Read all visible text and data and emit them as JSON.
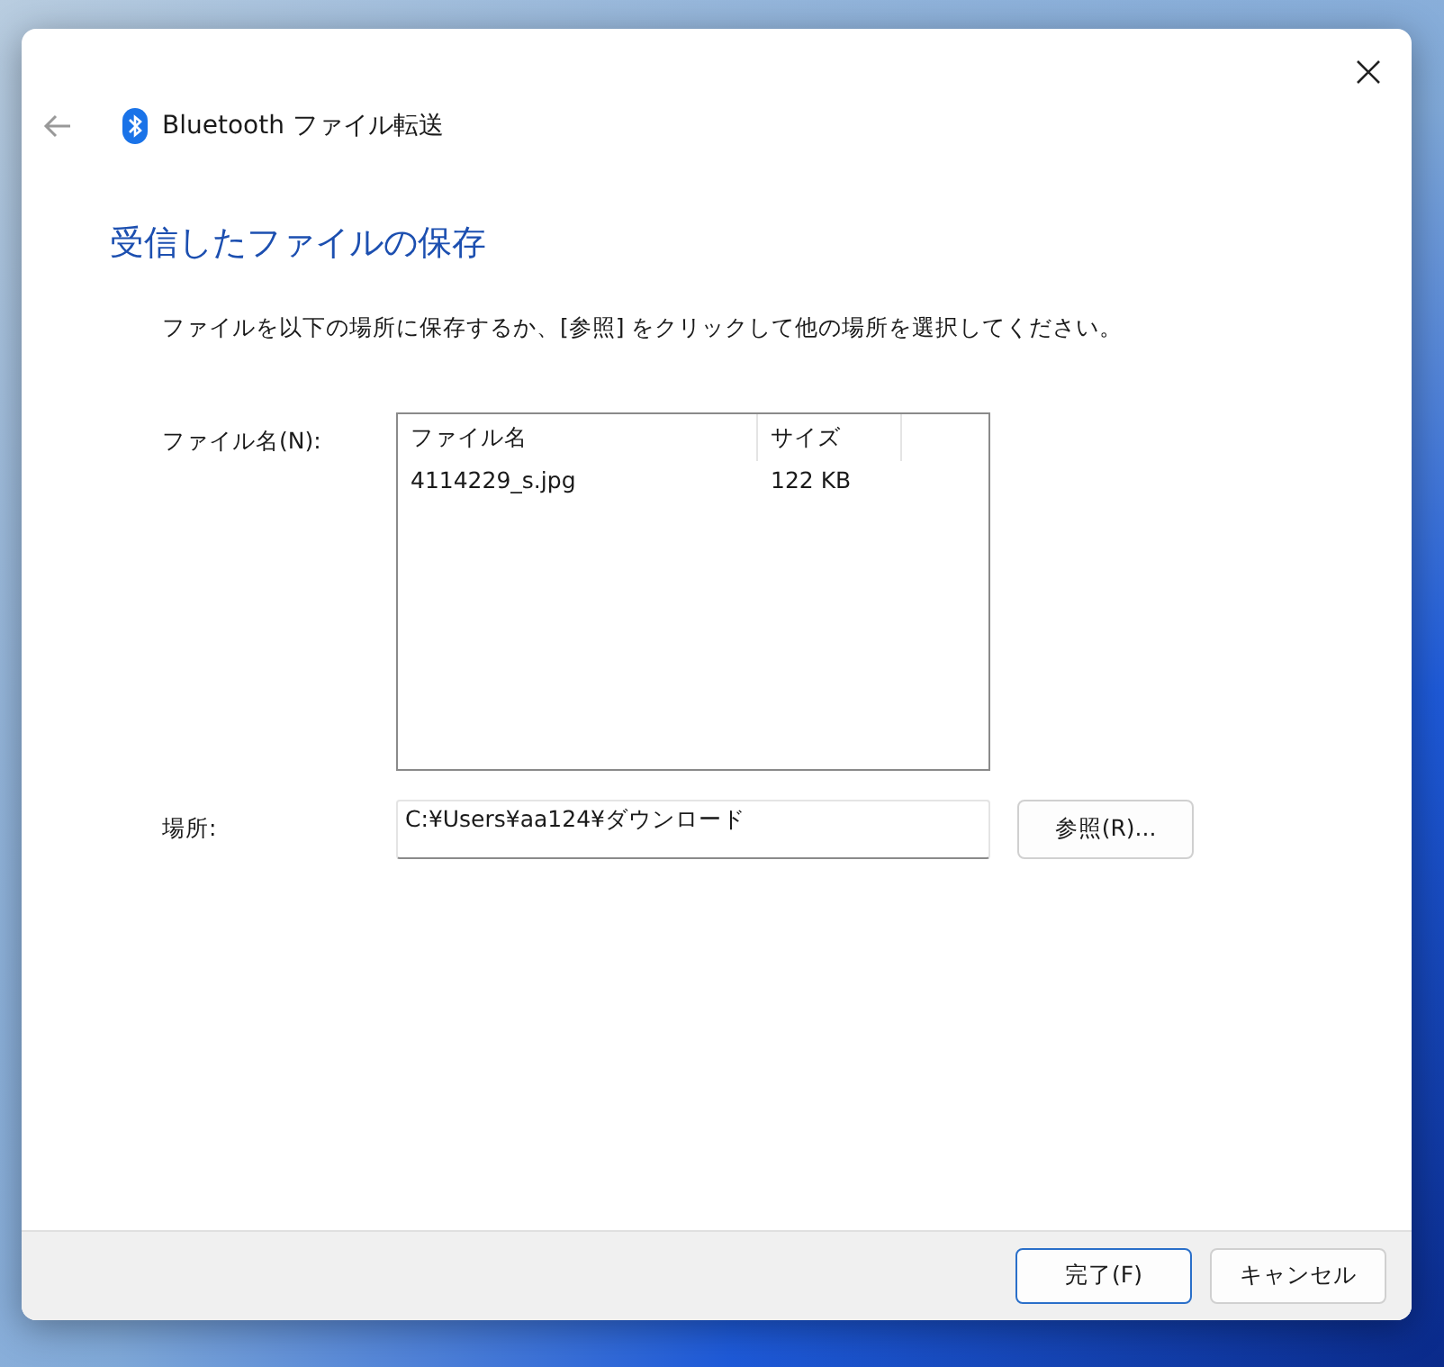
{
  "window": {
    "title": "Bluetooth ファイル転送"
  },
  "heading": "受信したファイルの保存",
  "instruction": "ファイルを以下の場所に保存するか、[参照] をクリックして他の場所を選択してください。",
  "file_list": {
    "label": "ファイル名(N):",
    "columns": [
      "ファイル名",
      "サイズ"
    ],
    "rows": [
      [
        "4114229_s.jpg",
        "122 KB"
      ]
    ]
  },
  "location": {
    "label": "場所:",
    "value": "C:¥Users¥aa124¥ダウンロード",
    "browse_button": "参照(R)..."
  },
  "buttons": [
    {
      "label": "完了(F)",
      "kind": "default"
    },
    {
      "label": "キャンセル",
      "kind": "normal"
    }
  ]
}
